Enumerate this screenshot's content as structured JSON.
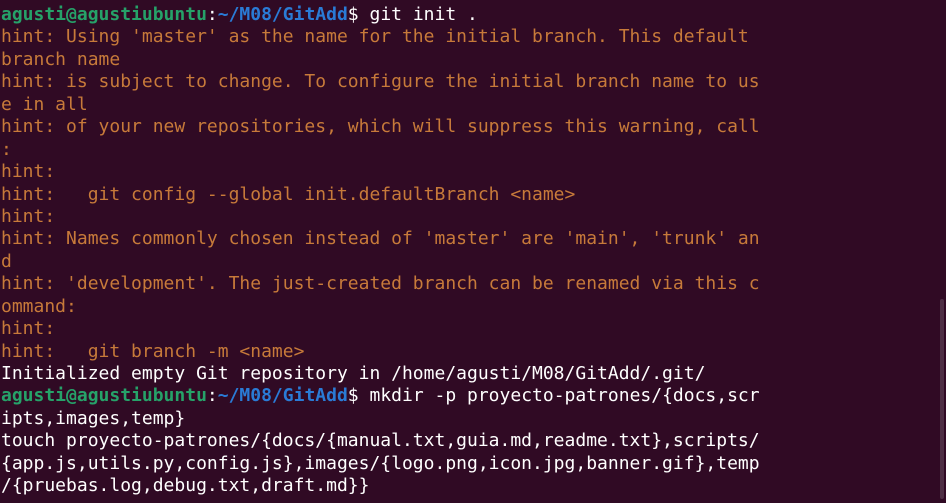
{
  "prompt": {
    "user": "agusti@agustiubuntu",
    "colon": ":",
    "path": "~/M08/GitAdd",
    "dollar": "$"
  },
  "lines": [
    {
      "type": "prompt",
      "command": " git init ."
    },
    {
      "type": "hint",
      "text": "hint: Using 'master' as the name for the initial branch. This default"
    },
    {
      "type": "hint",
      "text": "branch name"
    },
    {
      "type": "hint",
      "text": "hint: is subject to change. To configure the initial branch name to us"
    },
    {
      "type": "hint",
      "text": "e in all"
    },
    {
      "type": "hint",
      "text": "hint: of your new repositories, which will suppress this warning, call"
    },
    {
      "type": "hint",
      "text": ":"
    },
    {
      "type": "hint",
      "text": "hint:"
    },
    {
      "type": "hint",
      "text": "hint:   git config --global init.defaultBranch <name>"
    },
    {
      "type": "hint",
      "text": "hint:"
    },
    {
      "type": "hint",
      "text": "hint: Names commonly chosen instead of 'master' are 'main', 'trunk' an"
    },
    {
      "type": "hint",
      "text": "d"
    },
    {
      "type": "hint",
      "text": "hint: 'development'. The just-created branch can be renamed via this c"
    },
    {
      "type": "hint",
      "text": "ommand:"
    },
    {
      "type": "hint",
      "text": "hint:"
    },
    {
      "type": "hint",
      "text": "hint:   git branch -m <name>"
    },
    {
      "type": "out",
      "text": "Initialized empty Git repository in /home/agusti/M08/GitAdd/.git/"
    },
    {
      "type": "prompt",
      "command": " mkdir -p proyecto-patrones/{docs,scr"
    },
    {
      "type": "out",
      "text": "ipts,images,temp}"
    },
    {
      "type": "out",
      "text": "touch proyecto-patrones/{docs/{manual.txt,guia.md,readme.txt},scripts/"
    },
    {
      "type": "out",
      "text": "{app.js,utils.py,config.js},images/{logo.png,icon.jpg,banner.gif},temp"
    },
    {
      "type": "out",
      "text": "/{pruebas.log,debug.txt,draft.md}}"
    }
  ],
  "colors": {
    "background": "#300a24",
    "user": "#26a269",
    "path": "#2a7bd6",
    "hint": "#c77a3a",
    "text": "#ffffff"
  }
}
